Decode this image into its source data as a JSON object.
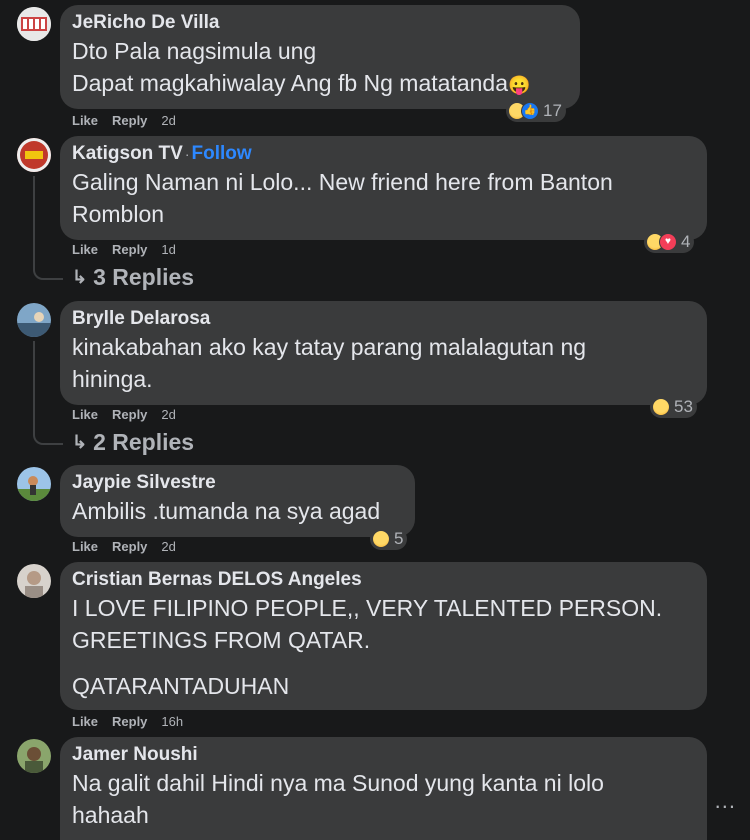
{
  "comments": [
    {
      "author": "JeRicho De Villa",
      "lines": [
        "Dto Pala nagsimula ung",
        "Dapat magkahiwalay Ang fb Ng matatanda"
      ],
      "emoji": "😛",
      "like": "Like",
      "reply": "Reply",
      "time": "2d",
      "reaction_count": "17",
      "reactions": [
        "haha",
        "like"
      ]
    },
    {
      "author": "Katigson TV",
      "follow": "Follow",
      "lines": [
        "Galing Naman ni Lolo... New friend here from Banton",
        "Romblon"
      ],
      "like": "Like",
      "reply": "Reply",
      "time": "1d",
      "reaction_count": "4",
      "reactions": [
        "haha",
        "love"
      ],
      "replies_label": "3 Replies"
    },
    {
      "author": "Brylle Delarosa",
      "lines": [
        "kinakabahan ako kay tatay parang malalagutan ng",
        "hininga."
      ],
      "like": "Like",
      "reply": "Reply",
      "time": "2d",
      "reaction_count": "53",
      "reactions": [
        "haha"
      ],
      "replies_label": "2 Replies"
    },
    {
      "author": "Jaypie Silvestre",
      "lines": [
        "Ambilis .tumanda na sya agad"
      ],
      "like": "Like",
      "reply": "Reply",
      "time": "2d",
      "reaction_count": "5",
      "reactions": [
        "haha"
      ]
    },
    {
      "author": "Cristian Bernas DELOS Angeles",
      "lines": [
        "I LOVE FILIPINO PEOPLE,, VERY TALENTED PERSON.",
        "GREETINGS FROM QATAR.",
        "",
        "QATARANTADUHAN"
      ],
      "like": "Like",
      "reply": "Reply",
      "time": "16h"
    },
    {
      "author": "Jamer Noushi",
      "lines": [
        "Na galit dahil Hindi nya ma Sunod yung kanta ni lolo",
        "hahaah"
      ]
    }
  ],
  "more_label": "..."
}
